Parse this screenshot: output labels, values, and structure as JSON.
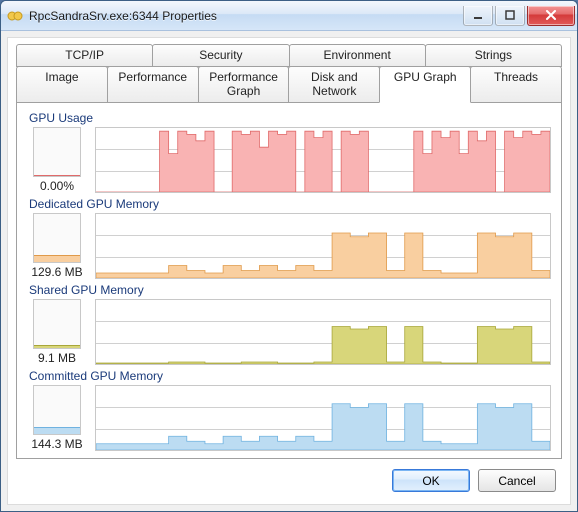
{
  "window": {
    "title": "RpcSandraSrv.exe:6344 Properties"
  },
  "tabs_row1": [
    {
      "label": "TCP/IP"
    },
    {
      "label": "Security"
    },
    {
      "label": "Environment"
    },
    {
      "label": "Strings"
    }
  ],
  "tabs_row2": [
    {
      "label": "Image"
    },
    {
      "label": "Performance"
    },
    {
      "label": "Performance Graph"
    },
    {
      "label": "Disk and Network"
    },
    {
      "label": "GPU Graph",
      "active": true
    },
    {
      "label": "Threads"
    }
  ],
  "colors": {
    "gpu_usage": {
      "fill": "#f9b3b3",
      "stroke": "#e06a6a"
    },
    "dedicated": {
      "fill": "#f9cfa0",
      "stroke": "#e09a4a"
    },
    "shared": {
      "fill": "#d8d67a",
      "stroke": "#a8a63a"
    },
    "committed": {
      "fill": "#bcdcf2",
      "stroke": "#6fb2e0"
    }
  },
  "sections": {
    "gpu_usage": {
      "label": "GPU Usage",
      "value": "0.00%",
      "mini_fill_pct": 2
    },
    "dedicated": {
      "label": "Dedicated GPU Memory",
      "value": "129.6 MB",
      "mini_fill_pct": 14
    },
    "shared": {
      "label": "Shared GPU Memory",
      "value": "9.1 MB",
      "mini_fill_pct": 6
    },
    "committed": {
      "label": "Committed GPU Memory",
      "value": "144.3 MB",
      "mini_fill_pct": 14
    }
  },
  "footer": {
    "ok": "OK",
    "cancel": "Cancel"
  },
  "chart_data": [
    {
      "type": "area",
      "name": "GPU Usage",
      "ylabel": "%",
      "ylim": [
        0,
        100
      ],
      "x": [
        0,
        2,
        4,
        6,
        8,
        10,
        12,
        14,
        16,
        18,
        20,
        22,
        24,
        26,
        28,
        30,
        32,
        34,
        36,
        38,
        40,
        42,
        44,
        46,
        48,
        50,
        52,
        54,
        56,
        58,
        60,
        62,
        64,
        66,
        68,
        70,
        72,
        74,
        76,
        78,
        80,
        82,
        84,
        86,
        88,
        90,
        92,
        94,
        96,
        98,
        100
      ],
      "values": [
        0,
        0,
        0,
        0,
        0,
        0,
        0,
        95,
        60,
        95,
        90,
        80,
        95,
        0,
        0,
        95,
        90,
        95,
        70,
        95,
        90,
        95,
        0,
        95,
        85,
        95,
        0,
        95,
        90,
        95,
        0,
        0,
        0,
        0,
        0,
        95,
        60,
        95,
        85,
        95,
        60,
        95,
        80,
        95,
        0,
        95,
        85,
        95,
        90,
        95,
        95
      ]
    },
    {
      "type": "area",
      "name": "Dedicated GPU Memory",
      "ylabel": "MB",
      "ylim": [
        0,
        512
      ],
      "x": [
        0,
        4,
        8,
        12,
        16,
        20,
        24,
        28,
        32,
        36,
        40,
        44,
        48,
        52,
        56,
        60,
        64,
        68,
        72,
        76,
        80,
        84,
        88,
        92,
        96,
        100
      ],
      "values": [
        40,
        40,
        40,
        40,
        100,
        60,
        40,
        100,
        60,
        100,
        60,
        100,
        60,
        360,
        330,
        360,
        60,
        360,
        60,
        40,
        40,
        360,
        330,
        360,
        60,
        60
      ]
    },
    {
      "type": "area",
      "name": "Shared GPU Memory",
      "ylabel": "MB",
      "ylim": [
        0,
        256
      ],
      "x": [
        0,
        8,
        16,
        24,
        32,
        40,
        48,
        52,
        56,
        60,
        64,
        68,
        72,
        76,
        80,
        84,
        88,
        92,
        96,
        100
      ],
      "values": [
        4,
        4,
        8,
        4,
        8,
        4,
        8,
        150,
        140,
        150,
        8,
        150,
        8,
        4,
        4,
        150,
        140,
        150,
        8,
        4
      ]
    },
    {
      "type": "area",
      "name": "Committed GPU Memory",
      "ylabel": "MB",
      "ylim": [
        0,
        512
      ],
      "x": [
        0,
        4,
        8,
        12,
        16,
        20,
        24,
        28,
        32,
        36,
        40,
        44,
        48,
        52,
        56,
        60,
        64,
        68,
        72,
        76,
        80,
        84,
        88,
        92,
        96,
        100
      ],
      "values": [
        50,
        50,
        50,
        50,
        110,
        70,
        50,
        110,
        70,
        110,
        70,
        110,
        70,
        370,
        340,
        370,
        70,
        370,
        70,
        50,
        50,
        370,
        340,
        370,
        70,
        70
      ]
    }
  ]
}
